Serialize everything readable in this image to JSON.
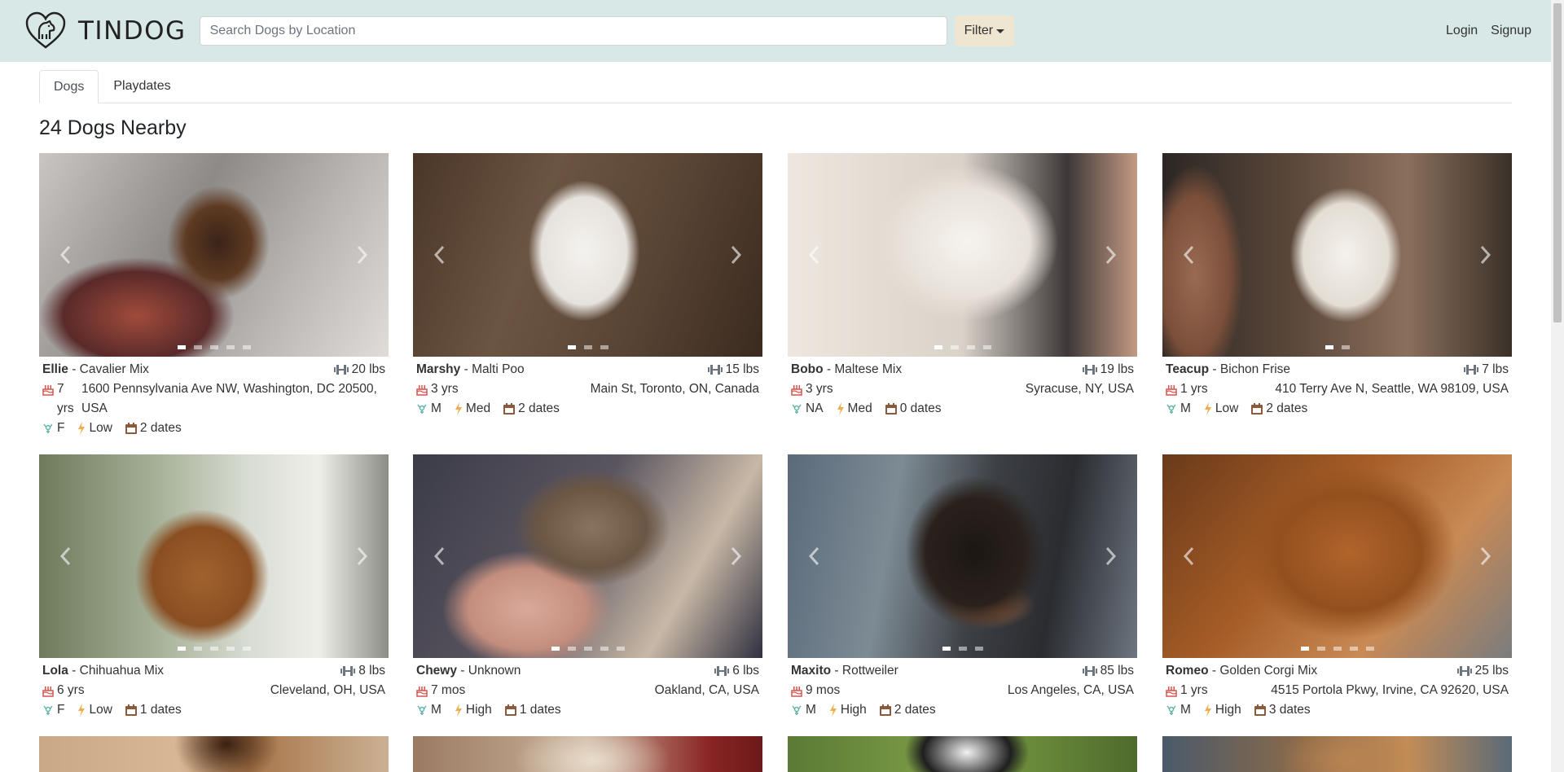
{
  "app": {
    "brand": "TINDOG"
  },
  "search": {
    "placeholder": "Search Dogs by Location"
  },
  "nav": {
    "filter_label": "Filter",
    "login_label": "Login",
    "signup_label": "Signup"
  },
  "tabs": [
    {
      "label": "Dogs",
      "active": true
    },
    {
      "label": "Playdates",
      "active": false
    }
  ],
  "heading": "24 Dogs Nearby",
  "colors": {
    "navbar": "#d8e8e6",
    "filter_button": "#efe6d2",
    "age_icon": "#d9534f",
    "sex_icon": "#5fb3a8",
    "energy_icon": "#f0ad4e",
    "dates_icon": "#8b5a3c"
  },
  "dogs": [
    {
      "name": "Ellie",
      "breed": "Cavalier Mix",
      "weight": "20 lbs",
      "age_num": "7",
      "age_unit": "yrs",
      "location": "1600 Pennsylvania Ave NW, Washington, DC 20500, USA",
      "sex": "F",
      "energy": "Low",
      "dates": "2 dates",
      "photos": 5,
      "active_photo": 0
    },
    {
      "name": "Marshy",
      "breed": "Malti Poo",
      "weight": "15 lbs",
      "age": "3 yrs",
      "location": "Main St, Toronto, ON, Canada",
      "sex": "M",
      "energy": "Med",
      "dates": "2 dates",
      "photos": 3,
      "active_photo": 0
    },
    {
      "name": "Bobo",
      "breed": "Maltese Mix",
      "weight": "19 lbs",
      "age": "3 yrs",
      "location": "Syracuse, NY, USA",
      "sex": "NA",
      "energy": "Med",
      "dates": "0 dates",
      "photos": 4,
      "active_photo": 0
    },
    {
      "name": "Teacup",
      "breed": "Bichon Frise",
      "weight": "7 lbs",
      "age": "1 yrs",
      "location": "410 Terry Ave N, Seattle, WA 98109, USA",
      "sex": "M",
      "energy": "Low",
      "dates": "2 dates",
      "photos": 2,
      "active_photo": 0
    },
    {
      "name": "Lola",
      "breed": "Chihuahua Mix",
      "weight": "8 lbs",
      "age": "6 yrs",
      "location": "Cleveland, OH, USA",
      "sex": "F",
      "energy": "Low",
      "dates": "1 dates",
      "photos": 5,
      "active_photo": 0
    },
    {
      "name": "Chewy",
      "breed": "Unknown",
      "weight": "6 lbs",
      "age": "7 mos",
      "location": "Oakland, CA, USA",
      "sex": "M",
      "energy": "High",
      "dates": "1 dates",
      "photos": 5,
      "active_photo": 0
    },
    {
      "name": "Maxito",
      "breed": "Rottweiler",
      "weight": "85 lbs",
      "age": "9 mos",
      "location": "Los Angeles, CA, USA",
      "sex": "M",
      "energy": "High",
      "dates": "2 dates",
      "photos": 3,
      "active_photo": 0
    },
    {
      "name": "Romeo",
      "breed": "Golden Corgi Mix",
      "weight": "25 lbs",
      "age": "1 yrs",
      "location": "4515 Portola Pkwy, Irvine, CA 92620, USA",
      "sex": "M",
      "energy": "High",
      "dates": "3 dates",
      "photos": 5,
      "active_photo": 0
    }
  ],
  "icons": {
    "logo": "heart-dog-logo",
    "weight": "dumbbell-icon",
    "age": "birthday-cake-icon",
    "sex": "gender-icon",
    "energy": "lightning-icon",
    "dates": "calendar-icon",
    "prev": "chevron-left-icon",
    "next": "chevron-right-icon"
  }
}
